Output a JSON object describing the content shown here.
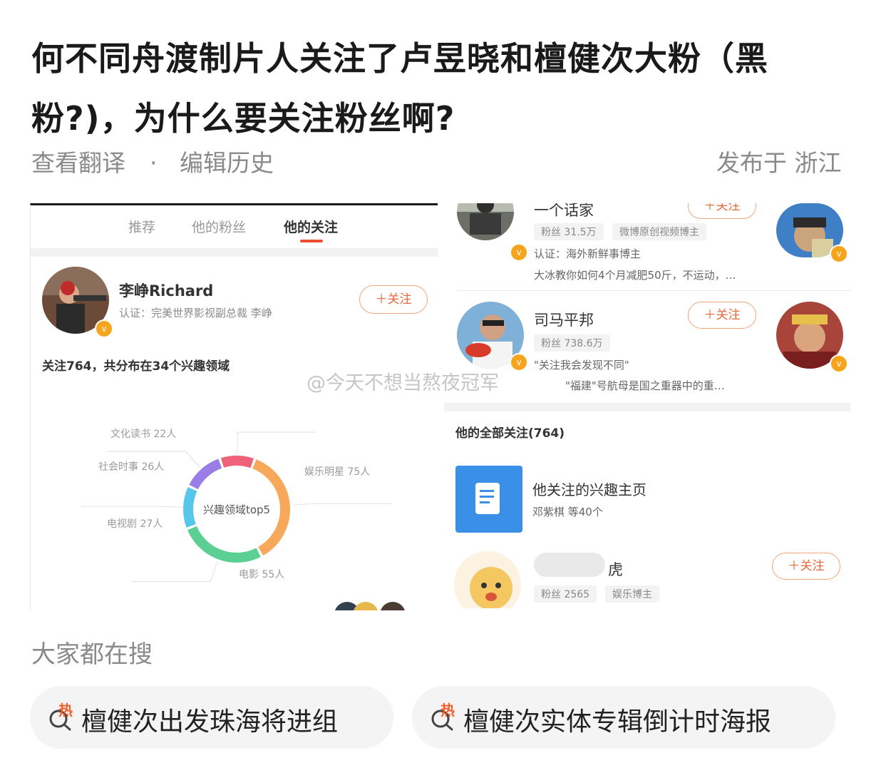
{
  "question": {
    "title": "何不同舟渡制片人关注了卢昱晓和檀健次大粉（黑粉?)，为什么要关注粉丝啊?",
    "view_translation": "查看翻译",
    "separator": "·",
    "edit_history": "编辑历史",
    "published_location": "发布于 浙江"
  },
  "left_shot": {
    "tabs": [
      {
        "label": "推荐",
        "active": false
      },
      {
        "label": "他的粉丝",
        "active": false
      },
      {
        "label": "他的关注",
        "active": true
      }
    ],
    "profile": {
      "name": "李峥Richard",
      "verification": "认证：完美世界影视副总裁 李峥",
      "follow_label": "＋关注"
    },
    "follow_summary": "关注764，共分布在34个兴趣领域",
    "chart_data": {
      "type": "pie",
      "title": "兴趣领域top5",
      "categories": [
        "娱乐明星",
        "电影",
        "电视剧",
        "社会时事",
        "文化读书"
      ],
      "values": [
        75,
        55,
        27,
        26,
        22
      ],
      "labels": [
        "娱乐明星 75人",
        "电影 55人",
        "电视剧 27人",
        "社会时事 26人",
        "文化读书 22人"
      ],
      "colors": [
        "#f7a85a",
        "#5ccf95",
        "#58c6ea",
        "#9b7de8",
        "#f0627a"
      ]
    }
  },
  "right_shot": {
    "users": [
      {
        "name": "一个话家",
        "fans": "粉丝 31.5万",
        "tag": "微博原创视频博主",
        "verification": "认证：海外新鲜事博主",
        "desc": "大冰教你如何4个月减肥50斤，不运动，…",
        "follow_label": "＋关注"
      },
      {
        "name": "司马平邦",
        "fans": "粉丝 738.6万",
        "verification": "\"关注我会发现不同\"",
        "desc": "\"福建\"号航母是国之重器中的重…",
        "follow_label": "＋关注"
      }
    ],
    "all_following_header": "他的全部关注(764)",
    "interest_page": {
      "title": "他关注的兴趣主页",
      "sub": "邓紫棋 等40个"
    },
    "last_user": {
      "name_visible_suffix": "虎",
      "fans": "粉丝 2565",
      "tag": "娱乐博主",
      "follow_label": "＋关注"
    }
  },
  "watermark": "@今天不想当熬夜冠军",
  "hot_search": {
    "section_title": "大家都在搜",
    "badge": "热",
    "items": [
      {
        "label": "檀健次出发珠海将进组"
      },
      {
        "label": "檀健次实体专辑倒计时海报"
      }
    ],
    "accent_color": "#f0602d"
  }
}
